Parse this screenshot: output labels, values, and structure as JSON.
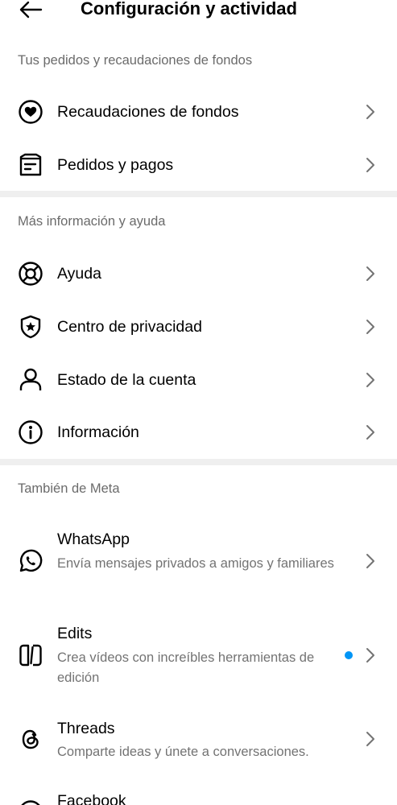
{
  "header": {
    "title": "Configuración y actividad"
  },
  "sections": [
    {
      "title": "Tus pedidos y recaudaciones de fondos",
      "items": [
        {
          "label": "Recaudaciones de fondos",
          "icon": "heart-circle-icon"
        },
        {
          "label": "Pedidos y pagos",
          "icon": "receipt-icon"
        }
      ]
    },
    {
      "title": "Más información y ayuda",
      "items": [
        {
          "label": "Ayuda",
          "icon": "lifebuoy-icon"
        },
        {
          "label": "Centro de privacidad",
          "icon": "shield-star-icon"
        },
        {
          "label": "Estado de la cuenta",
          "icon": "person-icon"
        },
        {
          "label": "Información",
          "icon": "info-icon"
        }
      ]
    },
    {
      "title": "También de Meta",
      "items": [
        {
          "label": "WhatsApp",
          "subtitle": "Envía mensajes privados a amigos y familiares",
          "icon": "whatsapp-icon"
        },
        {
          "label": "Edits",
          "subtitle": "Crea vídeos con increíbles herramientas de edición",
          "icon": "edits-icon",
          "badge": "blue-dot"
        },
        {
          "label": "Threads",
          "subtitle": "Comparte ideas y únete a conversaciones.",
          "icon": "threads-icon"
        },
        {
          "label": "Facebook",
          "icon": "facebook-icon"
        }
      ]
    }
  ],
  "colors": {
    "section_header": "#6b6b6b",
    "subtitle": "#737373",
    "divider": "#efefef",
    "badge_dot": "#0095f6"
  }
}
